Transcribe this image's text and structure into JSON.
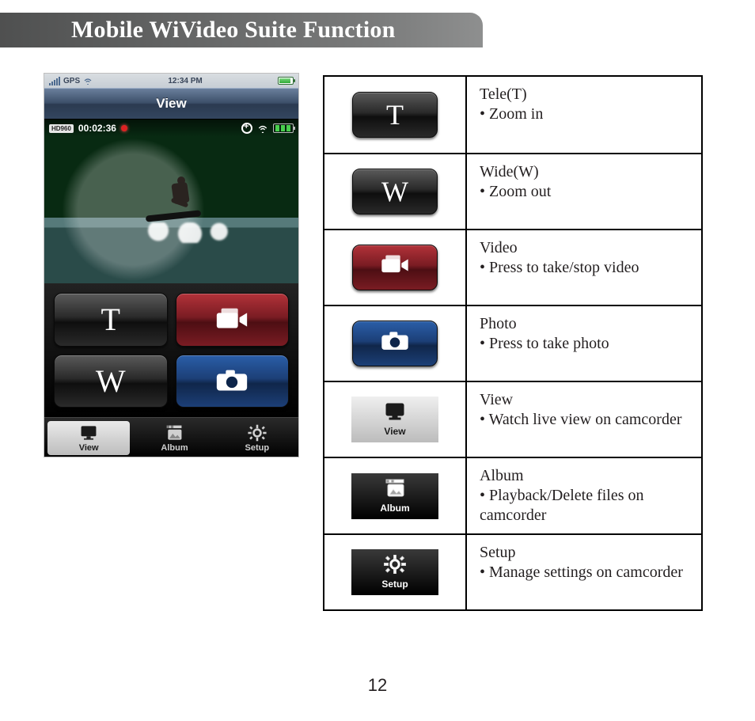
{
  "title": "Mobile WiVideo Suite Function",
  "page_number": "12",
  "status_bar": {
    "carrier": "GPS",
    "time": "12:34 PM"
  },
  "app": {
    "header": "View",
    "overlay": {
      "hd_badge": "HD960",
      "timer": "00:02:36"
    },
    "buttons": {
      "tele": "T",
      "wide": "W"
    },
    "tabs": {
      "view": "View",
      "album": "Album",
      "setup": "Setup"
    }
  },
  "legend": {
    "items": [
      {
        "icon_type": "chip-dark",
        "caption": "T",
        "name": "Tele(T)",
        "desc": "Zoom in"
      },
      {
        "icon_type": "chip-dark",
        "caption": "W",
        "name": "Wide(W)",
        "desc": "Zoom out"
      },
      {
        "icon_type": "chip-red",
        "glyph": "video",
        "name": "Video",
        "desc": "Press to take/stop video"
      },
      {
        "icon_type": "chip-blue",
        "glyph": "camera",
        "name": "Photo",
        "desc": "Press to take photo"
      },
      {
        "icon_type": "tab-light",
        "glyph": "monitor",
        "caption": "View",
        "name": "View",
        "desc": "Watch live view on camcorder"
      },
      {
        "icon_type": "tab-dark",
        "glyph": "album",
        "caption": "Album",
        "name": "Album",
        "desc": "Playback/Delete files on camcorder"
      },
      {
        "icon_type": "tab-dark",
        "glyph": "gear",
        "caption": "Setup",
        "name": "Setup",
        "desc": "Manage settings on camcorder"
      }
    ]
  }
}
